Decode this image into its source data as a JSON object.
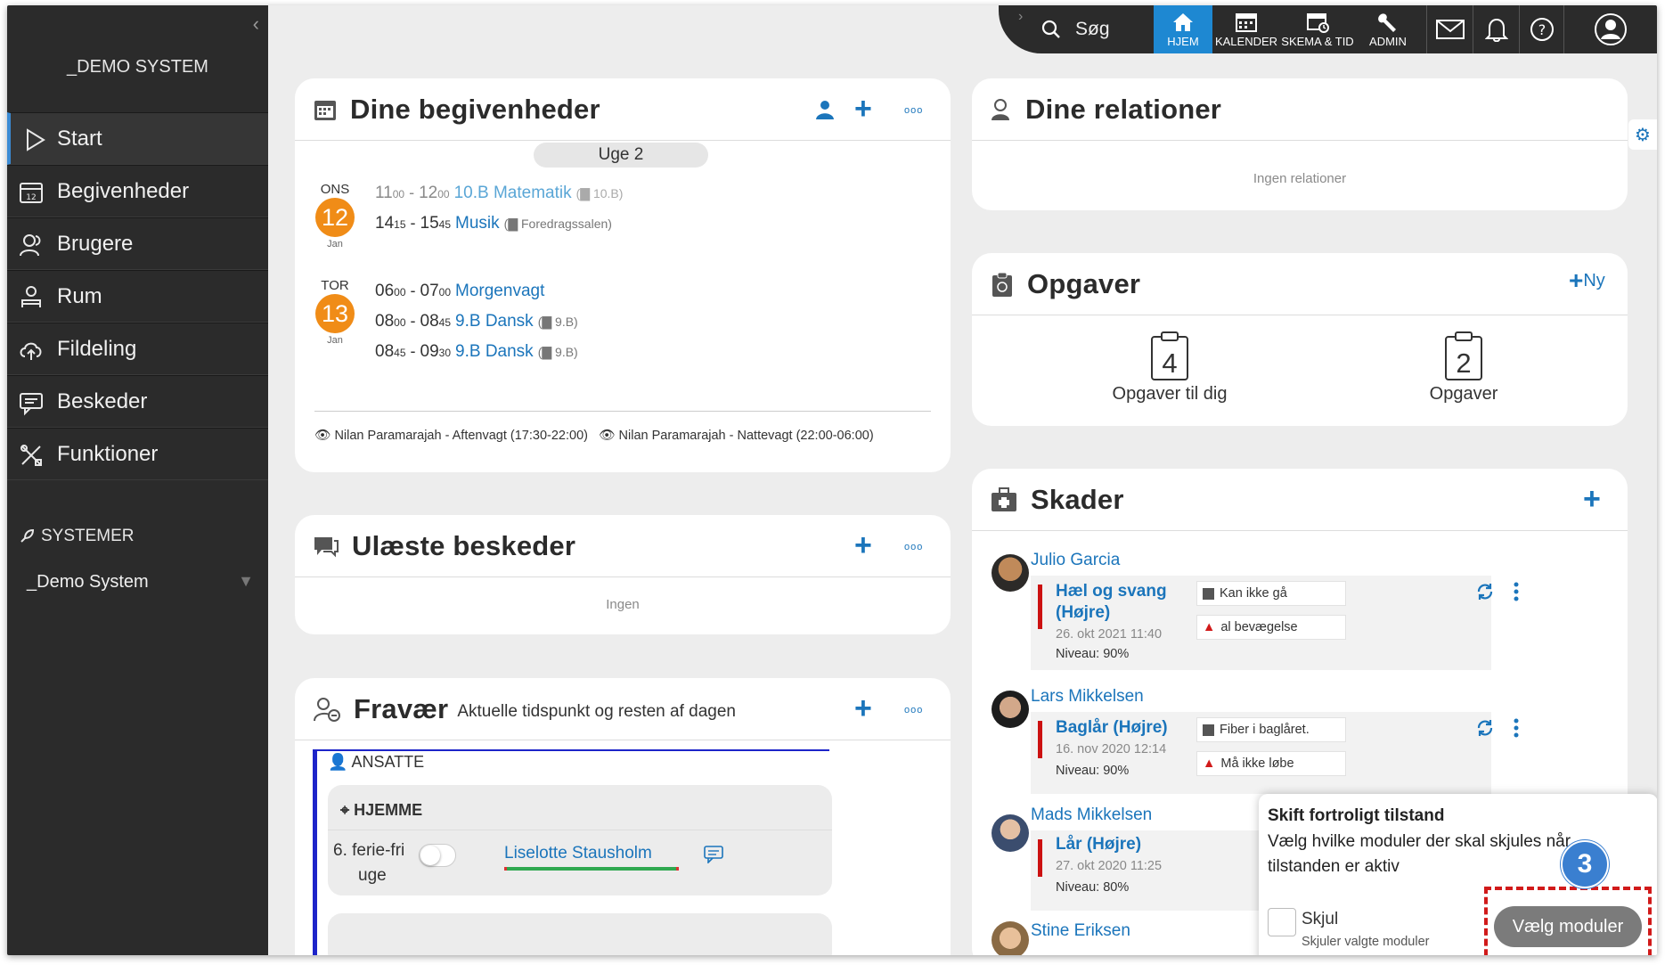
{
  "sidebar": {
    "system_title": "_DEMO SYSTEM",
    "items": [
      {
        "label": "Start",
        "icon": "play-icon"
      },
      {
        "label": "Begivenheder",
        "icon": "calendar-icon"
      },
      {
        "label": "Brugere",
        "icon": "users-icon"
      },
      {
        "label": "Rum",
        "icon": "room-icon"
      },
      {
        "label": "Fildeling",
        "icon": "cloud-upload-icon"
      },
      {
        "label": "Beskeder",
        "icon": "chat-icon"
      },
      {
        "label": "Funktioner",
        "icon": "tools-icon"
      }
    ],
    "systems_header": "SYSTEMER",
    "system_item": "_Demo System"
  },
  "topbar": {
    "search_label": "Søg",
    "home": "HJEM",
    "calendar": "KALENDER",
    "schedule": "SKEMA & TID",
    "admin": "ADMIN"
  },
  "events": {
    "title": "Dine begivenheder",
    "week": "Uge 2",
    "days": [
      {
        "weekday": "ONS",
        "day": "12",
        "month": "Jan"
      },
      {
        "weekday": "TOR",
        "day": "13",
        "month": "Jan"
      }
    ],
    "items": [
      {
        "sh": "11",
        "sm": "00",
        "eh": "12",
        "em": "00",
        "title": "10.B Matematik",
        "loc": "10.B"
      },
      {
        "sh": "14",
        "sm": "15",
        "eh": "15",
        "em": "45",
        "title": "Musik",
        "loc": "Foredragssalen"
      },
      {
        "sh": "06",
        "sm": "00",
        "eh": "07",
        "em": "00",
        "title": "Morgenvagt",
        "loc": ""
      },
      {
        "sh": "08",
        "sm": "00",
        "eh": "08",
        "em": "45",
        "title": "9.B Dansk",
        "loc": "9.B"
      },
      {
        "sh": "08",
        "sm": "45",
        "eh": "09",
        "em": "30",
        "title": "9.B Dansk",
        "loc": "9.B"
      }
    ],
    "watch1": "Nilan Paramarajah - Aftenvagt (17:30-22:00)",
    "watch2": "Nilan Paramarajah - Nattevagt (22:00-06:00)"
  },
  "messages": {
    "title": "Ulæste beskeder",
    "empty": "Ingen"
  },
  "absence": {
    "title": "Fravær",
    "subtitle": "Aktuelle tidspunkt og resten af dagen",
    "group": "ANSATTE",
    "location": "HJEMME",
    "reason_line1": "6. ferie-fri",
    "reason_line2": "uge",
    "person": "Liselotte Stausholm"
  },
  "relations": {
    "title": "Dine relationer",
    "empty": "Ingen relationer"
  },
  "tasks": {
    "title": "Opgaver",
    "new": "Ny",
    "mine_count": "4",
    "mine_label": "Opgaver til dig",
    "all_count": "2",
    "all_label": "Opgaver"
  },
  "injuries": {
    "title": "Skader",
    "rows": [
      {
        "name": "Julio Garcia",
        "injury1": "Hæl og svang",
        "injury2": "(Højre)",
        "date": "26. okt 2021 11:40",
        "level": "Niveau: 90%",
        "chip1": "Kan ikke gå",
        "chip2": "al bevægelse"
      },
      {
        "name": "Lars Mikkelsen",
        "injury1": "Baglår (Højre)",
        "date": "16. nov 2020 12:14",
        "level": "Niveau: 90%",
        "chip1": "Fiber i baglåret.",
        "chip2": "Må ikke løbe"
      },
      {
        "name": "Mads Mikkelsen",
        "injury1": "Lår (Højre)",
        "date": "27. okt 2020 11:25",
        "level": "Niveau: 80%"
      },
      {
        "name": "Stine Eriksen"
      }
    ]
  },
  "popover": {
    "title": "Skift fortroligt tilstand",
    "text": "Vælg hvilke moduler der skal skjules når tilstanden er aktiv",
    "checkbox_label": "Skjul",
    "checkbox_sub": "Skjuler valgte moduler",
    "button": "Vælg moduler",
    "step": "3"
  },
  "colors": {
    "accent": "#1b75bb",
    "orange": "#f08c17",
    "sidebar": "#2b2b2b",
    "highlight": "#d11a1a"
  }
}
